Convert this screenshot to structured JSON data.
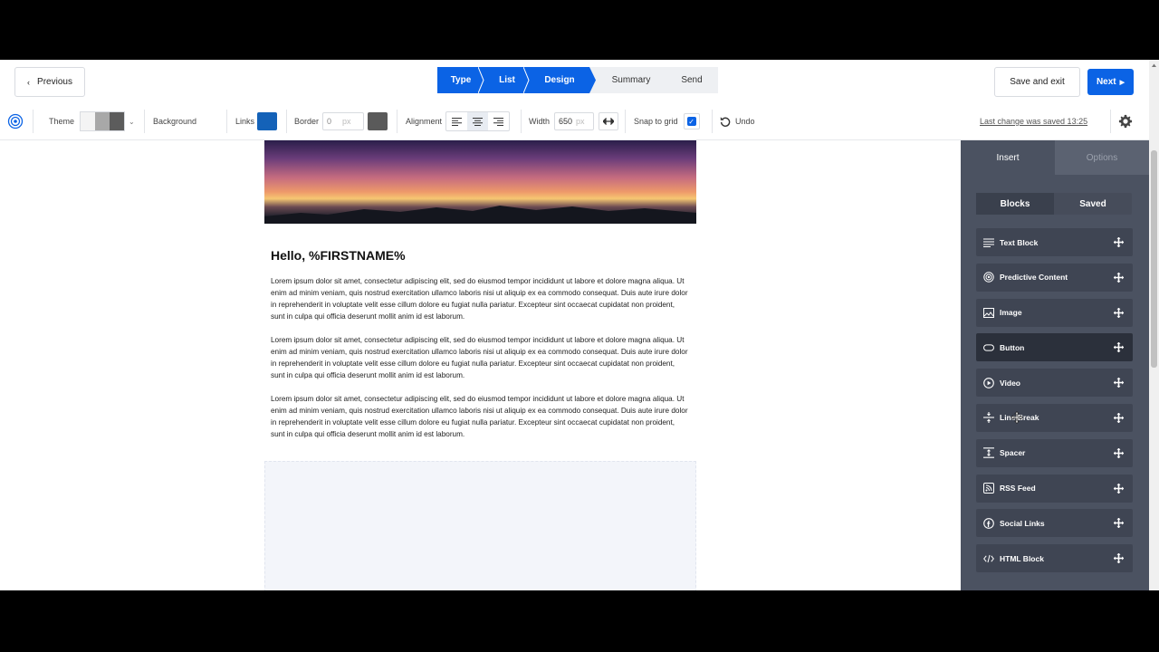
{
  "nav": {
    "previous_label": "Previous",
    "steps": [
      {
        "label": "Type",
        "state": "done"
      },
      {
        "label": "List",
        "state": "done"
      },
      {
        "label": "Design",
        "state": "current"
      },
      {
        "label": "Summary",
        "state": "upcoming"
      },
      {
        "label": "Send",
        "state": "upcoming"
      }
    ],
    "save_exit_label": "Save and exit",
    "next_label": "Next"
  },
  "toolbar": {
    "theme_label": "Theme",
    "background_label": "Background",
    "links_label": "Links",
    "links_color": "#1462b8",
    "border_label": "Border",
    "border_value": "0",
    "border_unit": "px",
    "alignment_label": "Alignment",
    "alignment_selected": "center",
    "width_label": "Width",
    "width_value": "650",
    "width_unit": "px",
    "snap_label": "Snap to grid",
    "snap_checked": true,
    "undo_label": "Undo",
    "last_saved": "Last change was saved 13:25"
  },
  "email": {
    "greeting": "Hello, %FIRSTNAME%",
    "paragraphs": [
      "Lorem ipsum dolor sit amet, consectetur adipiscing elit, sed do eiusmod tempor incididunt ut labore et dolore magna aliqua. Ut enim ad minim veniam, quis nostrud exercitation ullamco laboris nisi ut aliquip ex ea commodo consequat. Duis aute irure dolor in reprehenderit in voluptate velit esse cillum dolore eu fugiat nulla pariatur. Excepteur sint occaecat cupidatat non proident, sunt in culpa qui officia deserunt mollit anim id est laborum.",
      "Lorem ipsum dolor sit amet, consectetur adipiscing elit, sed do eiusmod tempor incididunt ut labore et dolore magna aliqua. Ut enim ad minim veniam, quis nostrud exercitation ullamco laboris nisi ut aliquip ex ea commodo consequat. Duis aute irure dolor in reprehenderit in voluptate velit esse cillum dolore eu fugiat nulla pariatur. Excepteur sint occaecat cupidatat non proident, sunt in culpa qui officia deserunt mollit anim id est laborum.",
      "Lorem ipsum dolor sit amet, consectetur adipiscing elit, sed do eiusmod tempor incididunt ut labore et dolore magna aliqua. Ut enim ad minim veniam, quis nostrud exercitation ullamco laboris nisi ut aliquip ex ea commodo consequat. Duis aute irure dolor in reprehenderit in voluptate velit esse cillum dolore eu fugiat nulla pariatur. Excepteur sint occaecat cupidatat non proident, sunt in culpa qui officia deserunt mollit anim id est laborum."
    ]
  },
  "panel": {
    "tabs": [
      {
        "label": "Insert",
        "active": true
      },
      {
        "label": "Options",
        "active": false
      }
    ],
    "segments": [
      {
        "label": "Blocks",
        "active": true
      },
      {
        "label": "Saved",
        "active": false
      }
    ],
    "blocks": [
      {
        "label": "Text Block",
        "icon": "text-lines-icon"
      },
      {
        "label": "Predictive Content",
        "icon": "target-icon"
      },
      {
        "label": "Image",
        "icon": "image-icon"
      },
      {
        "label": "Button",
        "icon": "button-pill-icon",
        "hover": true
      },
      {
        "label": "Video",
        "icon": "play-circle-icon"
      },
      {
        "label": "Line Break",
        "icon": "line-break-icon"
      },
      {
        "label": "Spacer",
        "icon": "spacer-icon"
      },
      {
        "label": "RSS Feed",
        "icon": "rss-icon"
      },
      {
        "label": "Social Links",
        "icon": "facebook-icon"
      },
      {
        "label": "HTML Block",
        "icon": "code-icon"
      }
    ]
  }
}
